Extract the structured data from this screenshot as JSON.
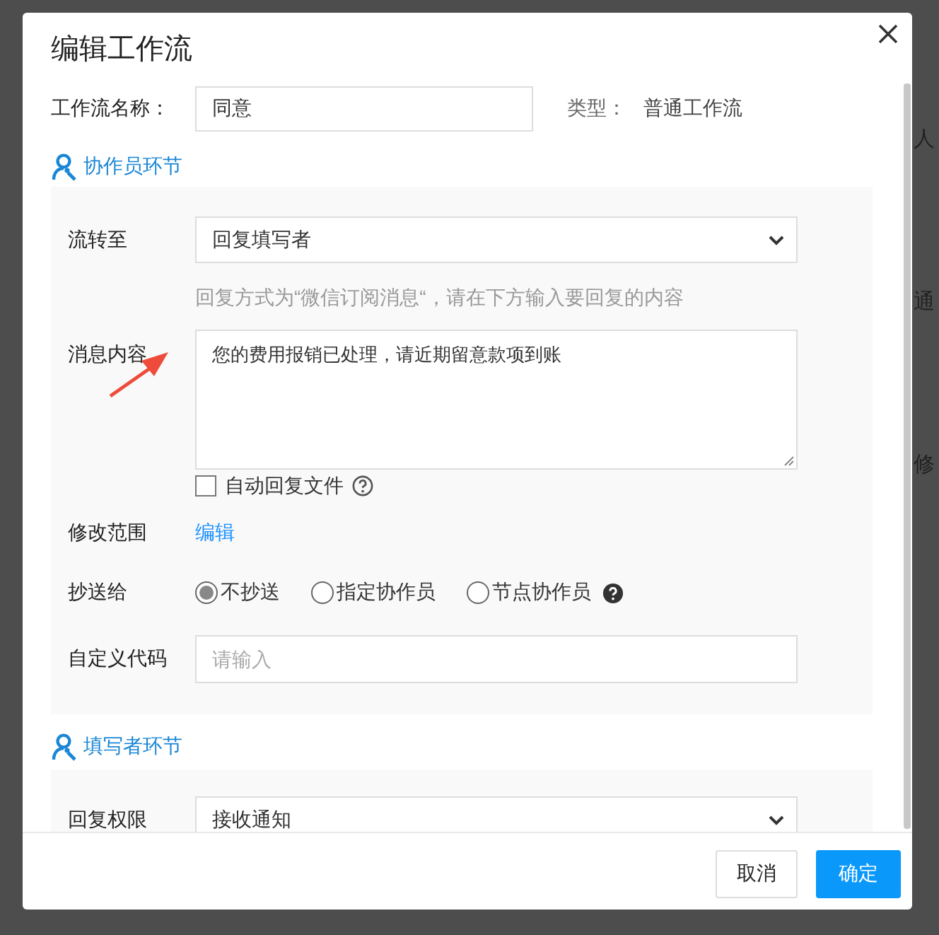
{
  "background_texts": [
    "人",
    "通",
    "修"
  ],
  "dialog": {
    "title": "编辑工作流",
    "name_field": {
      "label": "工作流名称：",
      "value": "同意"
    },
    "type": {
      "label": "类型：",
      "value": "普通工作流"
    },
    "sections": [
      {
        "title": "协作员环节",
        "rows": [
          {
            "kind": "select",
            "label": "流转至",
            "value": "回复填写者"
          },
          {
            "kind": "hint",
            "text": "回复方式为“微信订阅消息“，请在下方输入要回复的内容"
          },
          {
            "kind": "textarea",
            "label": "消息内容",
            "value": "您的费用报销已处理，请近期留意款项到账"
          },
          {
            "kind": "checkbox",
            "text": "自动回复文件",
            "checked": false,
            "help": true
          },
          {
            "kind": "link",
            "label": "修改范围",
            "text": "编辑"
          },
          {
            "kind": "radio",
            "label": "抄送给",
            "options": [
              {
                "text": "不抄送",
                "selected": true,
                "help": false
              },
              {
                "text": "指定协作员",
                "selected": false,
                "help": false
              },
              {
                "text": "节点协作员",
                "selected": false,
                "help": true
              }
            ]
          },
          {
            "kind": "input",
            "label": "自定义代码",
            "placeholder": "请输入"
          }
        ]
      },
      {
        "title": "填写者环节",
        "rows": [
          {
            "kind": "select",
            "label": "回复权限",
            "value": "接收通知"
          }
        ]
      }
    ],
    "buttons": [
      {
        "text": "取消",
        "primary": false
      },
      {
        "text": "确定",
        "primary": true
      }
    ]
  }
}
